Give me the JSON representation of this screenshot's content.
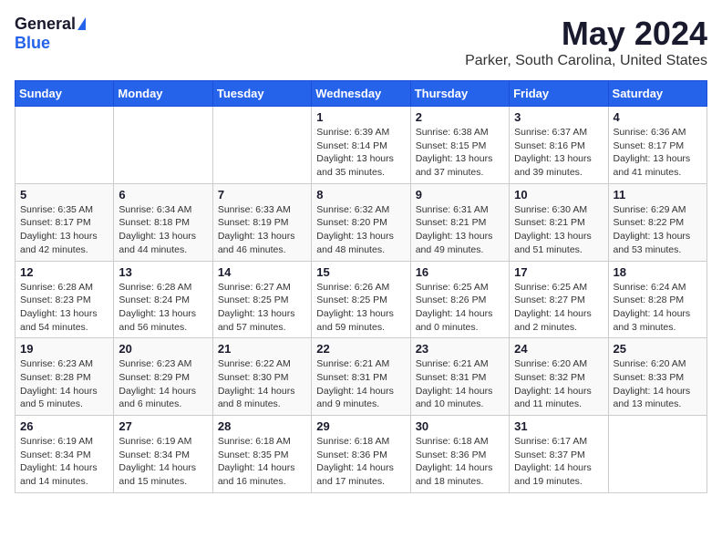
{
  "header": {
    "logo_general": "General",
    "logo_blue": "Blue",
    "title": "May 2024",
    "subtitle": "Parker, South Carolina, United States"
  },
  "calendar": {
    "weekdays": [
      "Sunday",
      "Monday",
      "Tuesday",
      "Wednesday",
      "Thursday",
      "Friday",
      "Saturday"
    ],
    "weeks": [
      [
        {
          "day": "",
          "info": ""
        },
        {
          "day": "",
          "info": ""
        },
        {
          "day": "",
          "info": ""
        },
        {
          "day": "1",
          "info": "Sunrise: 6:39 AM\nSunset: 8:14 PM\nDaylight: 13 hours\nand 35 minutes."
        },
        {
          "day": "2",
          "info": "Sunrise: 6:38 AM\nSunset: 8:15 PM\nDaylight: 13 hours\nand 37 minutes."
        },
        {
          "day": "3",
          "info": "Sunrise: 6:37 AM\nSunset: 8:16 PM\nDaylight: 13 hours\nand 39 minutes."
        },
        {
          "day": "4",
          "info": "Sunrise: 6:36 AM\nSunset: 8:17 PM\nDaylight: 13 hours\nand 41 minutes."
        }
      ],
      [
        {
          "day": "5",
          "info": "Sunrise: 6:35 AM\nSunset: 8:17 PM\nDaylight: 13 hours\nand 42 minutes."
        },
        {
          "day": "6",
          "info": "Sunrise: 6:34 AM\nSunset: 8:18 PM\nDaylight: 13 hours\nand 44 minutes."
        },
        {
          "day": "7",
          "info": "Sunrise: 6:33 AM\nSunset: 8:19 PM\nDaylight: 13 hours\nand 46 minutes."
        },
        {
          "day": "8",
          "info": "Sunrise: 6:32 AM\nSunset: 8:20 PM\nDaylight: 13 hours\nand 48 minutes."
        },
        {
          "day": "9",
          "info": "Sunrise: 6:31 AM\nSunset: 8:21 PM\nDaylight: 13 hours\nand 49 minutes."
        },
        {
          "day": "10",
          "info": "Sunrise: 6:30 AM\nSunset: 8:21 PM\nDaylight: 13 hours\nand 51 minutes."
        },
        {
          "day": "11",
          "info": "Sunrise: 6:29 AM\nSunset: 8:22 PM\nDaylight: 13 hours\nand 53 minutes."
        }
      ],
      [
        {
          "day": "12",
          "info": "Sunrise: 6:28 AM\nSunset: 8:23 PM\nDaylight: 13 hours\nand 54 minutes."
        },
        {
          "day": "13",
          "info": "Sunrise: 6:28 AM\nSunset: 8:24 PM\nDaylight: 13 hours\nand 56 minutes."
        },
        {
          "day": "14",
          "info": "Sunrise: 6:27 AM\nSunset: 8:25 PM\nDaylight: 13 hours\nand 57 minutes."
        },
        {
          "day": "15",
          "info": "Sunrise: 6:26 AM\nSunset: 8:25 PM\nDaylight: 13 hours\nand 59 minutes."
        },
        {
          "day": "16",
          "info": "Sunrise: 6:25 AM\nSunset: 8:26 PM\nDaylight: 14 hours\nand 0 minutes."
        },
        {
          "day": "17",
          "info": "Sunrise: 6:25 AM\nSunset: 8:27 PM\nDaylight: 14 hours\nand 2 minutes."
        },
        {
          "day": "18",
          "info": "Sunrise: 6:24 AM\nSunset: 8:28 PM\nDaylight: 14 hours\nand 3 minutes."
        }
      ],
      [
        {
          "day": "19",
          "info": "Sunrise: 6:23 AM\nSunset: 8:28 PM\nDaylight: 14 hours\nand 5 minutes."
        },
        {
          "day": "20",
          "info": "Sunrise: 6:23 AM\nSunset: 8:29 PM\nDaylight: 14 hours\nand 6 minutes."
        },
        {
          "day": "21",
          "info": "Sunrise: 6:22 AM\nSunset: 8:30 PM\nDaylight: 14 hours\nand 8 minutes."
        },
        {
          "day": "22",
          "info": "Sunrise: 6:21 AM\nSunset: 8:31 PM\nDaylight: 14 hours\nand 9 minutes."
        },
        {
          "day": "23",
          "info": "Sunrise: 6:21 AM\nSunset: 8:31 PM\nDaylight: 14 hours\nand 10 minutes."
        },
        {
          "day": "24",
          "info": "Sunrise: 6:20 AM\nSunset: 8:32 PM\nDaylight: 14 hours\nand 11 minutes."
        },
        {
          "day": "25",
          "info": "Sunrise: 6:20 AM\nSunset: 8:33 PM\nDaylight: 14 hours\nand 13 minutes."
        }
      ],
      [
        {
          "day": "26",
          "info": "Sunrise: 6:19 AM\nSunset: 8:34 PM\nDaylight: 14 hours\nand 14 minutes."
        },
        {
          "day": "27",
          "info": "Sunrise: 6:19 AM\nSunset: 8:34 PM\nDaylight: 14 hours\nand 15 minutes."
        },
        {
          "day": "28",
          "info": "Sunrise: 6:18 AM\nSunset: 8:35 PM\nDaylight: 14 hours\nand 16 minutes."
        },
        {
          "day": "29",
          "info": "Sunrise: 6:18 AM\nSunset: 8:36 PM\nDaylight: 14 hours\nand 17 minutes."
        },
        {
          "day": "30",
          "info": "Sunrise: 6:18 AM\nSunset: 8:36 PM\nDaylight: 14 hours\nand 18 minutes."
        },
        {
          "day": "31",
          "info": "Sunrise: 6:17 AM\nSunset: 8:37 PM\nDaylight: 14 hours\nand 19 minutes."
        },
        {
          "day": "",
          "info": ""
        }
      ]
    ]
  }
}
